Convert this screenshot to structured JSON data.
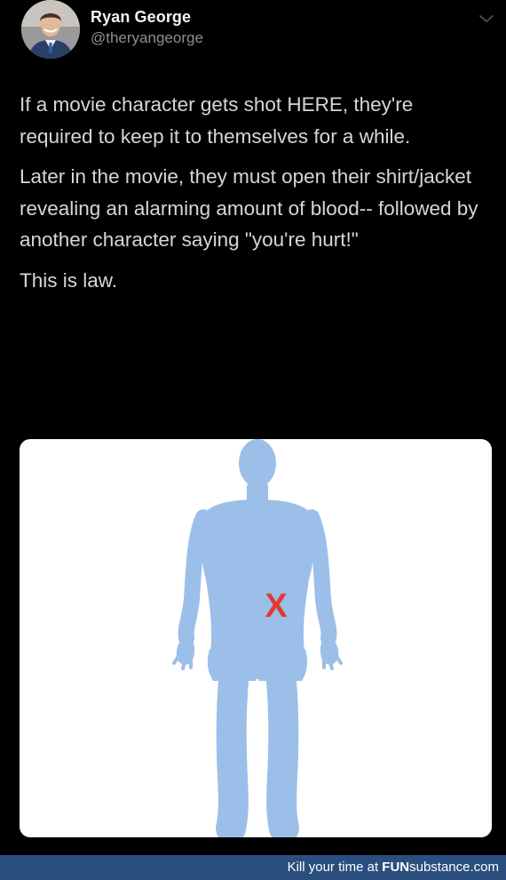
{
  "tweet": {
    "author": {
      "name": "Ryan George",
      "handle": "@theryangeorge",
      "avatar_icon": "user-avatar-photo"
    },
    "menu_icon": "chevron-down-icon",
    "paragraphs": [
      "If a movie character gets shot HERE, they're required to keep it to themselves for a while.",
      "Later in the movie, they must open their shirt/jacket revealing an alarming amount of blood-- followed by another character saying \"you're hurt!\"",
      "This is law."
    ],
    "media": {
      "description_icon": "human-body-figure",
      "marker_text": "X",
      "marker_color": "#e03b32",
      "figure_color": "#9bbfe8"
    }
  },
  "footer": {
    "prefix": "Kill your time at ",
    "brand_fun": "FUN",
    "brand_rest": "substance.com",
    "bar_color": "#2a4e7d"
  }
}
